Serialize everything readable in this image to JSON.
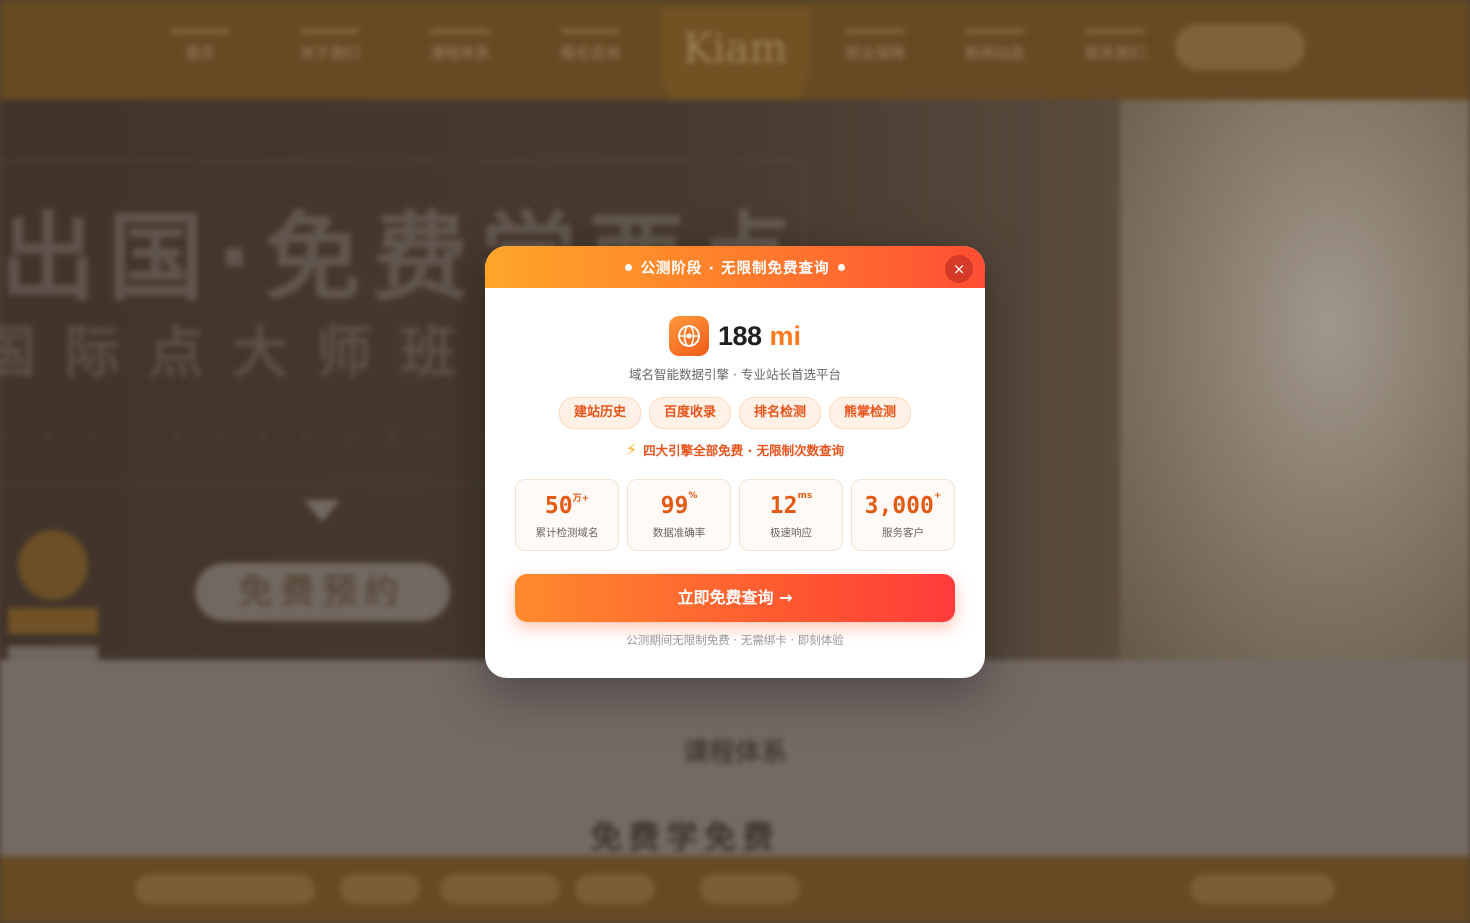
{
  "background": {
    "nav_left": [
      "首页",
      "关于我们",
      "课程体系",
      "报名咨询"
    ],
    "nav_right": [
      "就业保障",
      "新闻动态",
      "联系我们"
    ],
    "logo_text": "Kiam",
    "hero_title": "出国·免费学西点",
    "hero_subtitle": "国际点大师班",
    "hero_button": "免费预约",
    "section_title": "课程体系",
    "section_subtitle": "免费学免费"
  },
  "modal": {
    "banner_text": "公测阶段 · 无限制免费查询",
    "close_icon": "×",
    "brand": {
      "icon": "globe-icon",
      "name": "188",
      "accent": "mi"
    },
    "tagline": "域名智能数据引擎 · 专业站长首选平台",
    "feature_tags": [
      "建站历史",
      "百度收录",
      "排名检测",
      "熊掌检测"
    ],
    "promo": {
      "icon": "lightning-icon",
      "glyph": "⚡",
      "text": "四大引擎全部免费 · 无限制次数查询"
    },
    "stats": [
      {
        "value": "50",
        "suffix": "万+",
        "label": "累计检测域名"
      },
      {
        "value": "99",
        "suffix": "%",
        "label": "数据准确率"
      },
      {
        "value": "12",
        "suffix": "ms",
        "label": "极速响应"
      },
      {
        "value": "3,000",
        "suffix": "+",
        "label": "服务客户"
      }
    ],
    "cta_label": "立即免费查询 →",
    "footnote": "公测期间无限制免费 · 无需绑卡 · 即刻体验"
  },
  "colors": {
    "accent": "#ff7a1e",
    "banner_start": "#ffa62a",
    "banner_end": "#ff4e35",
    "close": "#d63a28",
    "stat_number": "#e35a14"
  }
}
